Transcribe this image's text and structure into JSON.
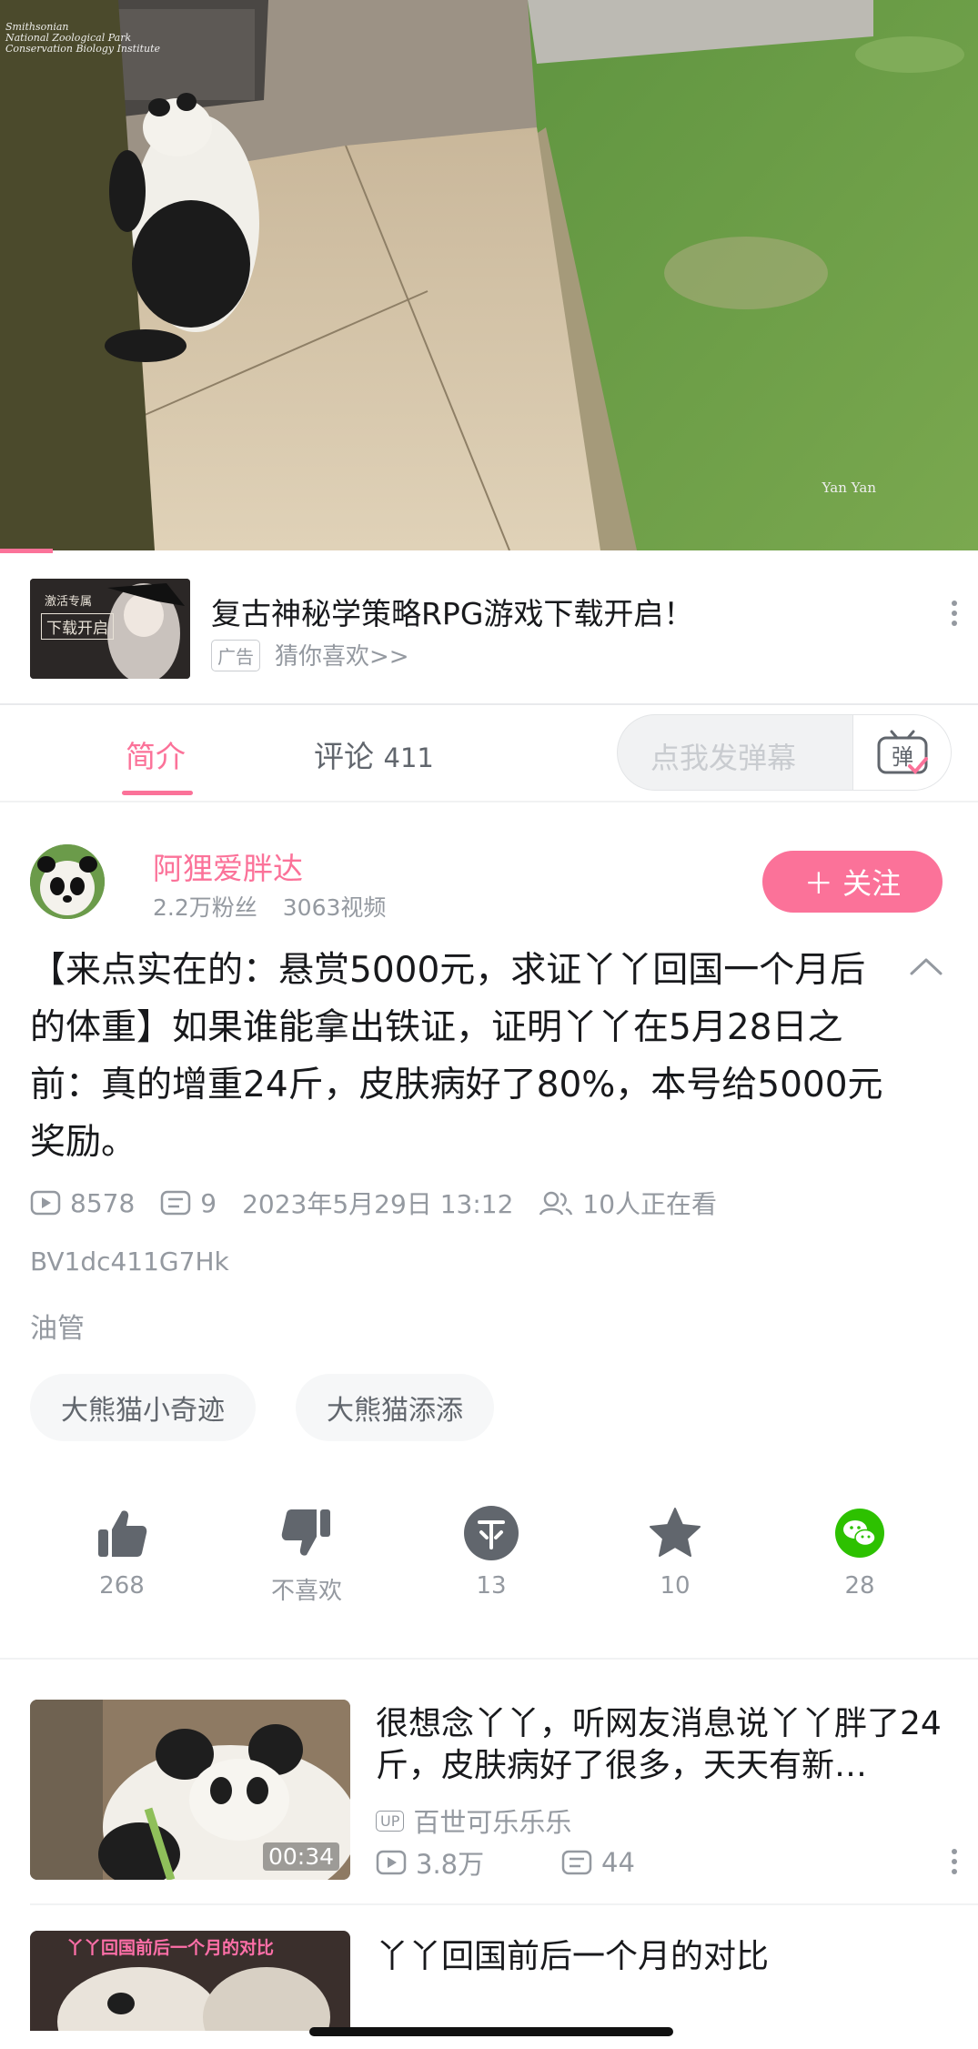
{
  "video": {
    "watermark_lines": [
      "Smithsonian",
      "National Zoological Park",
      "Conservation Biology Institute"
    ],
    "camera_label": "Yan Yan"
  },
  "ad": {
    "thumb_text": "下载开启",
    "thumb_small": "激活专属",
    "title": "复古神秘学策略RPG游戏下载开启！",
    "badge": "广告",
    "subtitle": "猜你喜欢>>"
  },
  "tabs": {
    "intro": "简介",
    "comments_label": "评论",
    "comments_count": "411",
    "danmu_placeholder": "点我发弹幕",
    "danmu_icon_char": "弹"
  },
  "uploader": {
    "name": "阿狸爱胖达",
    "fans": "2.2万粉丝",
    "videos": "3063视频",
    "follow_label": "＋ 关注"
  },
  "description": "【来点实在的：悬赏5000元，求证丫丫回国一个月后的体重】如果谁能拿出铁证，证明丫丫在5月28日之前：真的增重24斤，皮肤病好了80%，本号给5000元奖励。",
  "meta": {
    "plays": "8578",
    "danmaku": "9",
    "date": "2023年5月29日 13:12",
    "watching": "10人正在看",
    "bvid": "BV1dc411G7Hk",
    "source": "油管"
  },
  "tags": [
    "大熊猫小奇迹",
    "大熊猫添添"
  ],
  "actions": {
    "like": "268",
    "dislike": "不喜欢",
    "coin": "13",
    "favorite": "10",
    "share": "28"
  },
  "colors": {
    "accent": "#fb7299",
    "muted": "#9499a0",
    "wechat": "#2dc100"
  },
  "recommendations": [
    {
      "title": "很想念丫丫，听网友消息说丫丫胖了24斤，皮肤病好了很多，天天有新…",
      "duration": "00:34",
      "up_badge": "UP",
      "uploader": "百世可乐乐乐",
      "plays": "3.8万",
      "danmaku": "44"
    },
    {
      "title": "丫丫回国前后一个月的对比",
      "thumb_caption": "丫丫回国前后一个月的对比"
    }
  ]
}
